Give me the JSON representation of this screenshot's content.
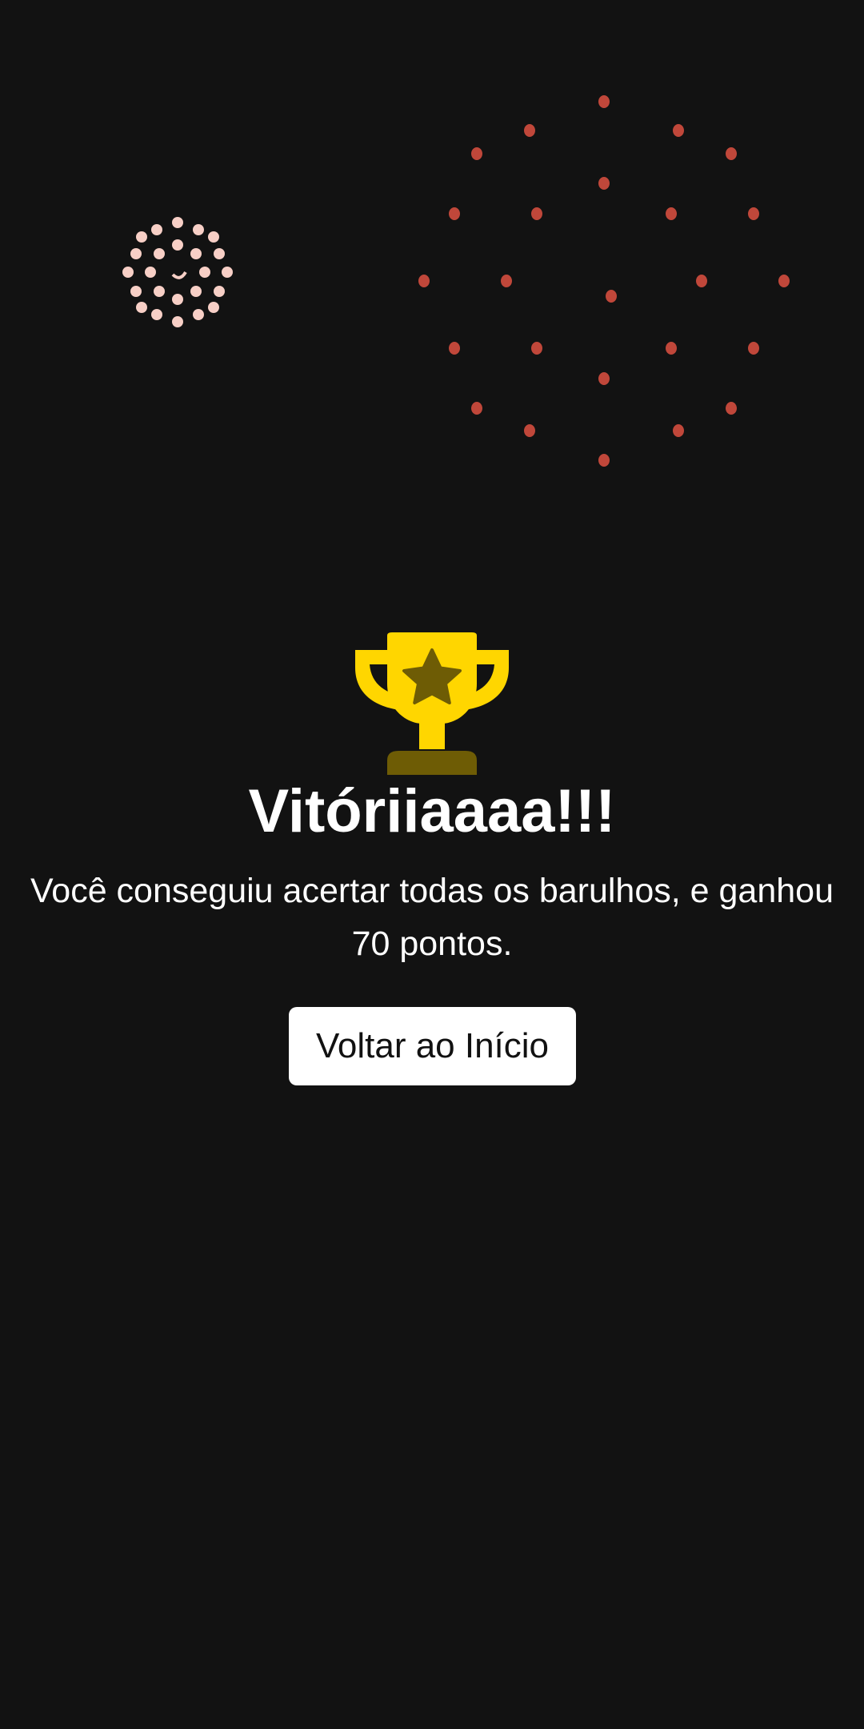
{
  "colors": {
    "background": "#121212",
    "trophy_gold": "#FFD600",
    "trophy_dark": "#6E5C05",
    "firework_red": "#C0473A",
    "firework_pink": "#F7CFC6",
    "button_bg": "#FFFFFF",
    "button_text": "#111111"
  },
  "icons": {
    "trophy": "trophy-icon",
    "star": "star-icon"
  },
  "result": {
    "title": "Vitóriiaaaa!!!",
    "message": "Você conseguiu acertar todas os barulhos, e ganhou 70 pontos.",
    "points": 70
  },
  "actions": {
    "back_home_label": "Voltar ao Início"
  }
}
